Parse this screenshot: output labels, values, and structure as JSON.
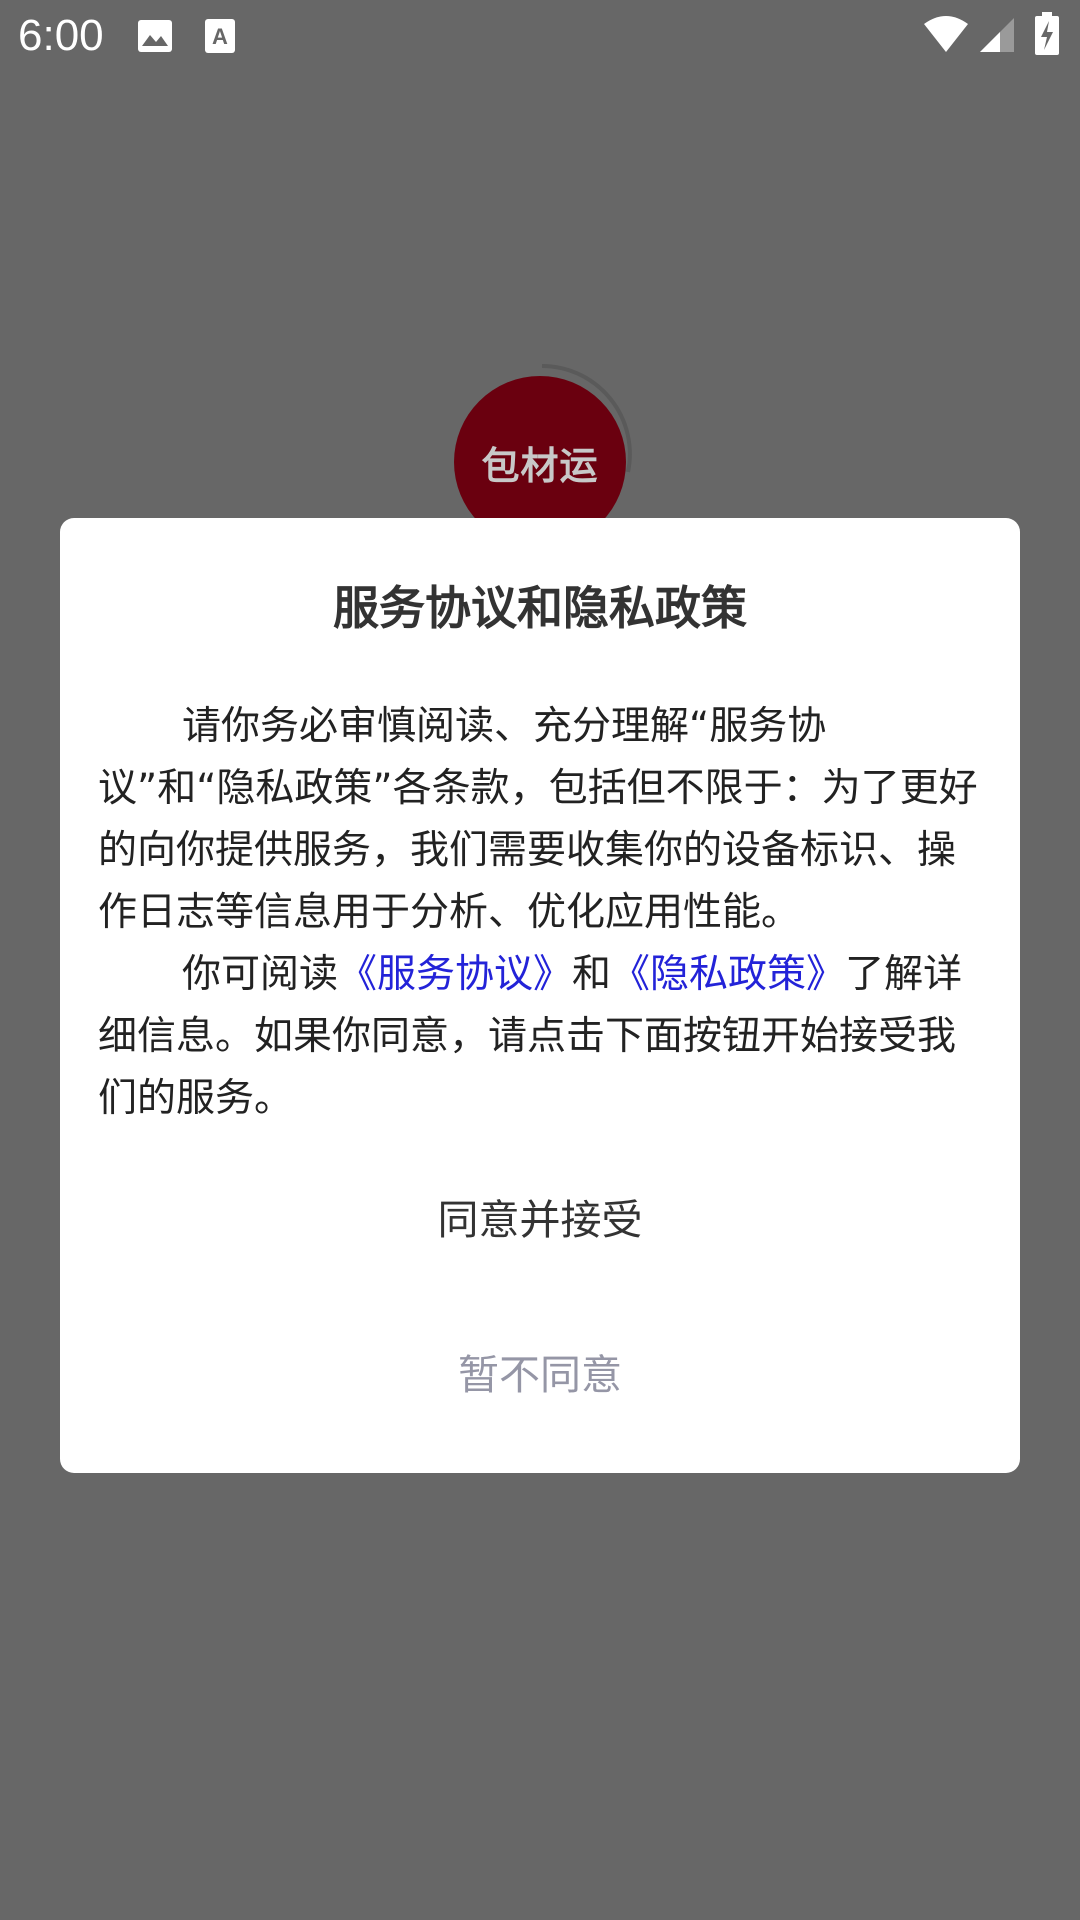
{
  "status_bar": {
    "time": "6:00",
    "icons": [
      "image-icon",
      "font-download-icon",
      "wifi-icon",
      "signal-icon",
      "battery-charging-icon"
    ]
  },
  "splash": {
    "logo_text": "包材运",
    "logo_color": "#6a000f"
  },
  "dialog": {
    "title": "服务协议和隐私政策",
    "para1": "请你务必审慎阅读、充分理解“服务协议”和“隐私政策”各条款，包括但不限于：为了更好的向你提供服务，我们需要收集你的设备标识、操作日志等信息用于分析、优化应用性能。",
    "para2_prefix": "你可阅读",
    "service_link": "《服务协议》",
    "para2_and": "和",
    "privacy_link": "《隐私政策》",
    "para2_suffix": "了解详细信息。如果你同意，请点击下面按钮开始接受我们的服务。",
    "agree_label": "同意并接受",
    "decline_label": "暂不同意",
    "link_color": "#2323d8"
  }
}
